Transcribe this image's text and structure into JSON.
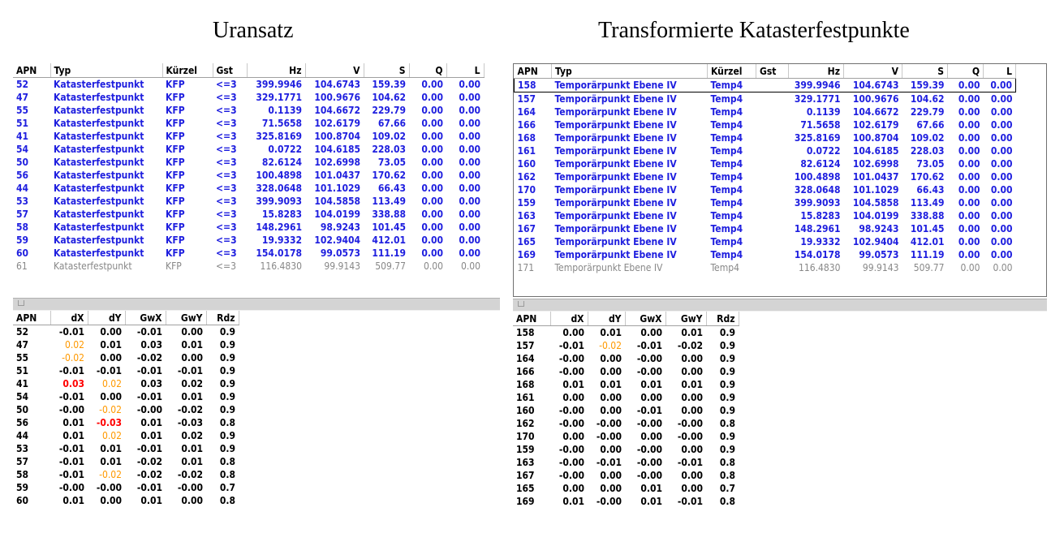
{
  "titles": {
    "left": "Uransatz",
    "right": "Transformierte Katasterfestpunkte"
  },
  "top_headers": [
    "APN",
    "Typ",
    "Kürzel",
    "Gst",
    "Hz",
    "V",
    "S",
    "Q",
    "L"
  ],
  "bottom_headers": [
    "APN",
    "dX",
    "dY",
    "GwX",
    "GwY",
    "Rdz"
  ],
  "left_top_rows": [
    [
      "52",
      "Katasterfestpunkt",
      "KFP",
      "<=3",
      "399.9946",
      "104.6743",
      "159.39",
      "0.00",
      "0.00"
    ],
    [
      "47",
      "Katasterfestpunkt",
      "KFP",
      "<=3",
      "329.1771",
      "100.9676",
      "104.62",
      "0.00",
      "0.00"
    ],
    [
      "55",
      "Katasterfestpunkt",
      "KFP",
      "<=3",
      "0.1139",
      "104.6672",
      "229.79",
      "0.00",
      "0.00"
    ],
    [
      "51",
      "Katasterfestpunkt",
      "KFP",
      "<=3",
      "71.5658",
      "102.6179",
      "67.66",
      "0.00",
      "0.00"
    ],
    [
      "41",
      "Katasterfestpunkt",
      "KFP",
      "<=3",
      "325.8169",
      "100.8704",
      "109.02",
      "0.00",
      "0.00"
    ],
    [
      "54",
      "Katasterfestpunkt",
      "KFP",
      "<=3",
      "0.0722",
      "104.6185",
      "228.03",
      "0.00",
      "0.00"
    ],
    [
      "50",
      "Katasterfestpunkt",
      "KFP",
      "<=3",
      "82.6124",
      "102.6998",
      "73.05",
      "0.00",
      "0.00"
    ],
    [
      "56",
      "Katasterfestpunkt",
      "KFP",
      "<=3",
      "100.4898",
      "101.0437",
      "170.62",
      "0.00",
      "0.00"
    ],
    [
      "44",
      "Katasterfestpunkt",
      "KFP",
      "<=3",
      "328.0648",
      "101.1029",
      "66.43",
      "0.00",
      "0.00"
    ],
    [
      "53",
      "Katasterfestpunkt",
      "KFP",
      "<=3",
      "399.9093",
      "104.5858",
      "113.49",
      "0.00",
      "0.00"
    ],
    [
      "57",
      "Katasterfestpunkt",
      "KFP",
      "<=3",
      "15.8283",
      "104.0199",
      "338.88",
      "0.00",
      "0.00"
    ],
    [
      "58",
      "Katasterfestpunkt",
      "KFP",
      "<=3",
      "148.2961",
      "98.9243",
      "101.45",
      "0.00",
      "0.00"
    ],
    [
      "59",
      "Katasterfestpunkt",
      "KFP",
      "<=3",
      "19.9332",
      "102.9404",
      "412.01",
      "0.00",
      "0.00"
    ],
    [
      "60",
      "Katasterfestpunkt",
      "KFP",
      "<=3",
      "154.0178",
      "99.0573",
      "111.19",
      "0.00",
      "0.00"
    ],
    [
      "61",
      "Katasterfestpunkt",
      "KFP",
      "<=3",
      "116.4830",
      "99.9143",
      "509.77",
      "0.00",
      "0.00"
    ]
  ],
  "right_top_rows": [
    [
      "158",
      "Temporärpunkt Ebene IV",
      "Temp4",
      "",
      "399.9946",
      "104.6743",
      "159.39",
      "0.00",
      "0.00"
    ],
    [
      "157",
      "Temporärpunkt Ebene IV",
      "Temp4",
      "",
      "329.1771",
      "100.9676",
      "104.62",
      "0.00",
      "0.00"
    ],
    [
      "164",
      "Temporärpunkt Ebene IV",
      "Temp4",
      "",
      "0.1139",
      "104.6672",
      "229.79",
      "0.00",
      "0.00"
    ],
    [
      "166",
      "Temporärpunkt Ebene IV",
      "Temp4",
      "",
      "71.5658",
      "102.6179",
      "67.66",
      "0.00",
      "0.00"
    ],
    [
      "168",
      "Temporärpunkt Ebene IV",
      "Temp4",
      "",
      "325.8169",
      "100.8704",
      "109.02",
      "0.00",
      "0.00"
    ],
    [
      "161",
      "Temporärpunkt Ebene IV",
      "Temp4",
      "",
      "0.0722",
      "104.6185",
      "228.03",
      "0.00",
      "0.00"
    ],
    [
      "160",
      "Temporärpunkt Ebene IV",
      "Temp4",
      "",
      "82.6124",
      "102.6998",
      "73.05",
      "0.00",
      "0.00"
    ],
    [
      "162",
      "Temporärpunkt Ebene IV",
      "Temp4",
      "",
      "100.4898",
      "101.0437",
      "170.62",
      "0.00",
      "0.00"
    ],
    [
      "170",
      "Temporärpunkt Ebene IV",
      "Temp4",
      "",
      "328.0648",
      "101.1029",
      "66.43",
      "0.00",
      "0.00"
    ],
    [
      "159",
      "Temporärpunkt Ebene IV",
      "Temp4",
      "",
      "399.9093",
      "104.5858",
      "113.49",
      "0.00",
      "0.00"
    ],
    [
      "163",
      "Temporärpunkt Ebene IV",
      "Temp4",
      "",
      "15.8283",
      "104.0199",
      "338.88",
      "0.00",
      "0.00"
    ],
    [
      "167",
      "Temporärpunkt Ebene IV",
      "Temp4",
      "",
      "148.2961",
      "98.9243",
      "101.45",
      "0.00",
      "0.00"
    ],
    [
      "165",
      "Temporärpunkt Ebene IV",
      "Temp4",
      "",
      "19.9332",
      "102.9404",
      "412.01",
      "0.00",
      "0.00"
    ],
    [
      "169",
      "Temporärpunkt Ebene IV",
      "Temp4",
      "",
      "154.0178",
      "99.0573",
      "111.19",
      "0.00",
      "0.00"
    ],
    [
      "171",
      "Temporärpunkt Ebene IV",
      "Temp4",
      "",
      "116.4830",
      "99.9143",
      "509.77",
      "0.00",
      "0.00"
    ]
  ],
  "left_bottom_rows": [
    [
      "52",
      "-0.01",
      "0.00",
      "-0.01",
      "0.00",
      "0.9"
    ],
    [
      "47",
      "0.02",
      "0.01",
      "0.03",
      "0.01",
      "0.9"
    ],
    [
      "55",
      "-0.02",
      "0.00",
      "-0.02",
      "0.00",
      "0.9"
    ],
    [
      "51",
      "-0.01",
      "-0.01",
      "-0.01",
      "-0.01",
      "0.9"
    ],
    [
      "41",
      "0.03",
      "0.02",
      "0.03",
      "0.02",
      "0.9"
    ],
    [
      "54",
      "-0.01",
      "0.00",
      "-0.01",
      "0.01",
      "0.9"
    ],
    [
      "50",
      "-0.00",
      "-0.02",
      "-0.00",
      "-0.02",
      "0.9"
    ],
    [
      "56",
      "0.01",
      "-0.03",
      "0.01",
      "-0.03",
      "0.8"
    ],
    [
      "44",
      "0.01",
      "0.02",
      "0.01",
      "0.02",
      "0.9"
    ],
    [
      "53",
      "-0.01",
      "0.01",
      "-0.01",
      "0.01",
      "0.9"
    ],
    [
      "57",
      "-0.01",
      "0.01",
      "-0.02",
      "0.01",
      "0.8"
    ],
    [
      "58",
      "-0.01",
      "-0.02",
      "-0.02",
      "-0.02",
      "0.8"
    ],
    [
      "59",
      "-0.00",
      "-0.00",
      "-0.01",
      "-0.00",
      "0.7"
    ],
    [
      "60",
      "0.01",
      "0.00",
      "0.01",
      "0.00",
      "0.8"
    ]
  ],
  "right_bottom_rows": [
    [
      "158",
      "0.00",
      "0.01",
      "0.00",
      "0.01",
      "0.9"
    ],
    [
      "157",
      "-0.01",
      "-0.02",
      "-0.01",
      "-0.02",
      "0.9"
    ],
    [
      "164",
      "-0.00",
      "0.00",
      "-0.00",
      "0.00",
      "0.9"
    ],
    [
      "166",
      "-0.00",
      "0.00",
      "-0.00",
      "0.00",
      "0.9"
    ],
    [
      "168",
      "0.01",
      "0.01",
      "0.01",
      "0.01",
      "0.9"
    ],
    [
      "161",
      "0.00",
      "0.00",
      "0.00",
      "0.00",
      "0.9"
    ],
    [
      "160",
      "-0.00",
      "0.00",
      "-0.01",
      "0.00",
      "0.9"
    ],
    [
      "162",
      "-0.00",
      "-0.00",
      "-0.00",
      "-0.00",
      "0.8"
    ],
    [
      "170",
      "0.00",
      "-0.00",
      "0.00",
      "-0.00",
      "0.9"
    ],
    [
      "159",
      "-0.00",
      "0.00",
      "-0.00",
      "0.00",
      "0.9"
    ],
    [
      "163",
      "-0.00",
      "-0.01",
      "-0.00",
      "-0.01",
      "0.8"
    ],
    [
      "167",
      "-0.00",
      "0.00",
      "-0.00",
      "0.00",
      "0.8"
    ],
    [
      "165",
      "0.00",
      "0.00",
      "0.01",
      "0.00",
      "0.7"
    ],
    [
      "169",
      "0.01",
      "-0.00",
      "0.01",
      "-0.01",
      "0.8"
    ]
  ],
  "highlights": {
    "left_bottom": [
      [
        1,
        1,
        "orange"
      ],
      [
        2,
        1,
        "orange"
      ],
      [
        4,
        1,
        "red"
      ],
      [
        4,
        2,
        "orange"
      ],
      [
        6,
        2,
        "orange"
      ],
      [
        7,
        2,
        "red"
      ],
      [
        8,
        2,
        "orange"
      ],
      [
        11,
        2,
        "orange"
      ]
    ],
    "right_bottom": [
      [
        1,
        2,
        "orange"
      ]
    ]
  },
  "colors": {
    "active_row": "#1f1fdf",
    "inactive_row": "#888888",
    "warning": "#ff9900",
    "error": "#ff0000"
  }
}
